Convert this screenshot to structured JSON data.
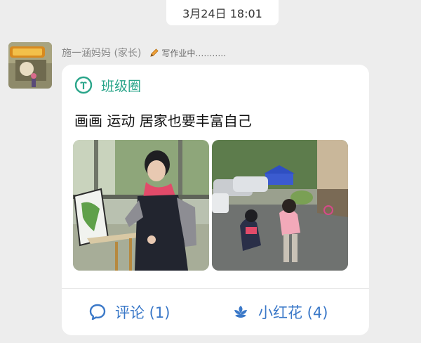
{
  "timestamp": "3月24日 18:01",
  "sender": {
    "name": "施一涵妈妈 (家长)",
    "status_text": "写作业中……….."
  },
  "post": {
    "channel_label": "班级圈",
    "text": "画画 运动 居家也要丰富自己",
    "photos": [
      "painting-photo",
      "outdoor-photo"
    ]
  },
  "actions": {
    "comment_label": "评论 (1)",
    "flower_label": "小红花 (4)"
  },
  "colors": {
    "background": "#ededed",
    "card": "#ffffff",
    "accent_green": "#2aa58a",
    "action_blue": "#3a78c8",
    "meta_gray": "#8a8a8a"
  }
}
